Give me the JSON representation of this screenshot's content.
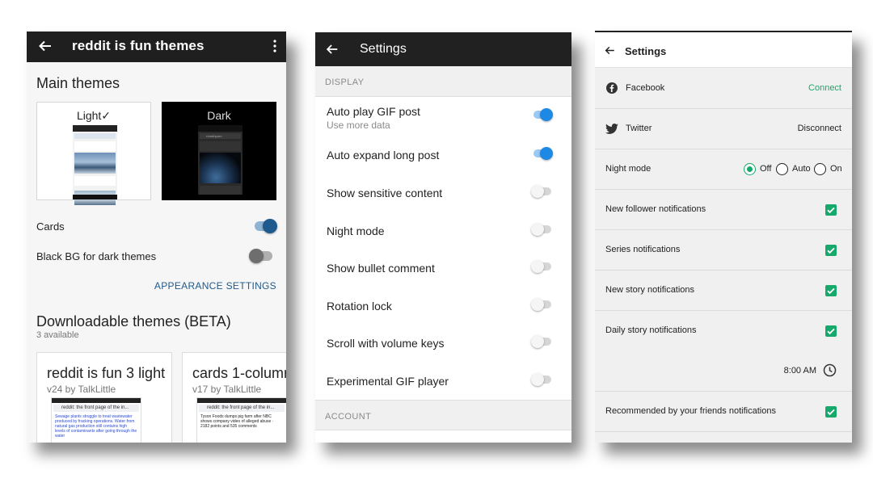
{
  "colors": {
    "reddit_toggle_on": "#1e5a8e",
    "settings_toggle_on": "#1e88e5",
    "green_accent": "#17a86b",
    "app_bar_dark": "#212121"
  },
  "panel1": {
    "title": "reddit is fun themes",
    "main_themes_heading": "Main themes",
    "themes": [
      {
        "label": "Light✓",
        "selected": true
      },
      {
        "label": "Dark",
        "selected": false
      }
    ],
    "mini_preview_address": "r/earthporn",
    "toggles": [
      {
        "label": "Cards",
        "on": true
      },
      {
        "label": "Black BG for dark themes",
        "on": false
      }
    ],
    "appearance_link": "APPEARANCE SETTINGS",
    "downloadable_heading": "Downloadable themes (BETA)",
    "available_count": "3 available",
    "cards": [
      {
        "name": "reddit is fun 3 light",
        "version": "v24 by TalkLittle",
        "address": "reddit: the front page of the in...",
        "snippet": "Sewage plants struggle to treat wastewater produced by fracking operations. Water from natural gas production still contains high levels of contaminants after going through the water"
      },
      {
        "name": "cards 1-column",
        "version": "v17 by TalkLittle",
        "address": "reddit: the front page of the in...",
        "snippet": "Tyson Foods dumps pig farm after NBC shows company video of alleged abuse · 2182 points and 535 comments"
      }
    ]
  },
  "panel2": {
    "title": "Settings",
    "display_header": "DISPLAY",
    "account_header": "ACCOUNT",
    "items": [
      {
        "label": "Auto play GIF post",
        "hint": "Use more data",
        "on": true
      },
      {
        "label": "Auto expand long post",
        "hint": "",
        "on": true
      },
      {
        "label": "Show sensitive content",
        "hint": "",
        "on": false
      },
      {
        "label": "Night mode",
        "hint": "",
        "on": false
      },
      {
        "label": "Show bullet comment",
        "hint": "",
        "on": false
      },
      {
        "label": "Rotation lock",
        "hint": "",
        "on": false
      },
      {
        "label": "Scroll with volume keys",
        "hint": "",
        "on": false
      },
      {
        "label": "Experimental GIF player",
        "hint": "",
        "on": false
      }
    ]
  },
  "panel3": {
    "title": "Settings",
    "facebook": {
      "label": "Facebook",
      "action": "Connect"
    },
    "twitter": {
      "label": "Twitter",
      "action": "Disconnect"
    },
    "night_mode": {
      "label": "Night mode",
      "options": [
        "Off",
        "Auto",
        "On"
      ],
      "selected": "Off"
    },
    "checkbox_rows": [
      {
        "label": "New follower notifications",
        "checked": true
      },
      {
        "label": "Series notifications",
        "checked": true
      },
      {
        "label": "New story notifications",
        "checked": true
      },
      {
        "label": "Daily story notifications",
        "checked": true
      }
    ],
    "daily_time": "8:00 AM",
    "recommended": {
      "label": "Recommended by your friends notifications",
      "checked": true
    }
  }
}
